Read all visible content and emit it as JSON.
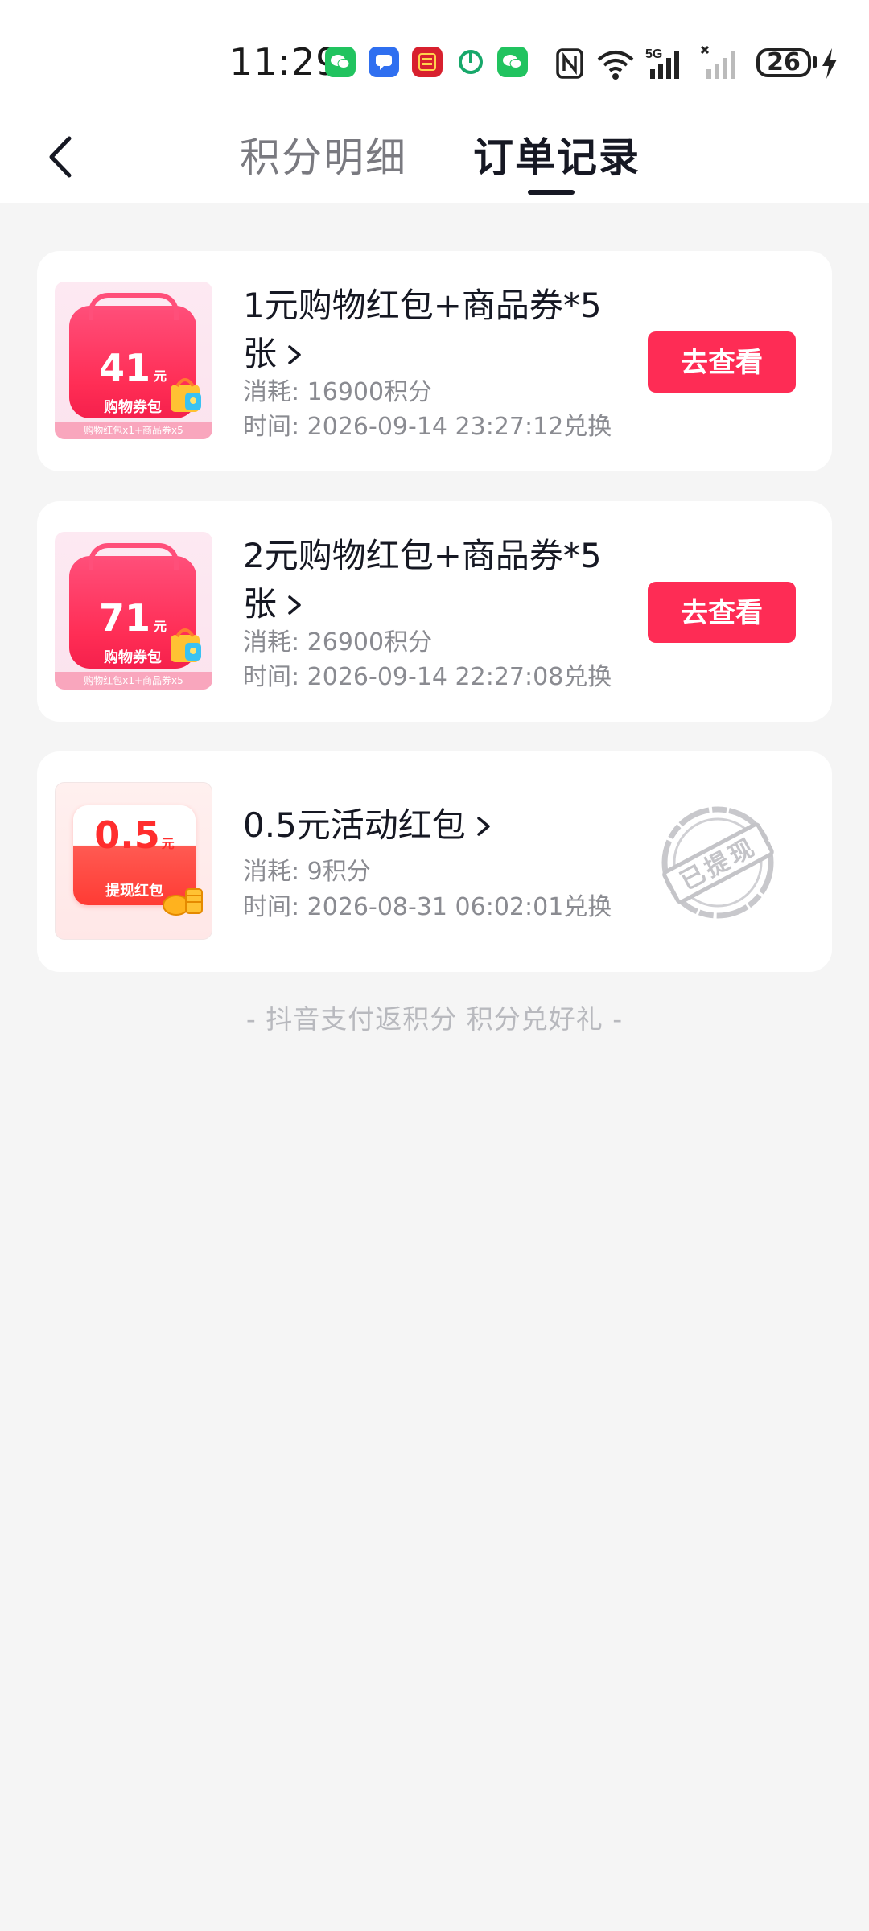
{
  "status_bar": {
    "time": "11:29",
    "app_icons": [
      "wechat-icon",
      "message-icon",
      "news-icon",
      "power-icon",
      "wechat-icon"
    ],
    "signal": "5G",
    "battery": "26"
  },
  "header": {
    "tabs": [
      {
        "label": "积分明细",
        "active": false
      },
      {
        "label": "订单记录",
        "active": true
      }
    ]
  },
  "orders": [
    {
      "title": "1元购物红包+商品券*5张",
      "thumb_amount": "41",
      "thumb_unit": "元",
      "thumb_label": "购物券包",
      "thumb_footer": "购物红包x1+商品券x5",
      "cost_label": "消耗:",
      "cost_value": "16900积分",
      "time_label": "时间:",
      "time_value": "2026-09-14 23:27:12兑换",
      "action_label": "去查看"
    },
    {
      "title": "2元购物红包+商品券*5张",
      "thumb_amount": "71",
      "thumb_unit": "元",
      "thumb_label": "购物券包",
      "thumb_footer": "购物红包x1+商品券x5",
      "cost_label": "消耗:",
      "cost_value": "26900积分",
      "time_label": "时间:",
      "time_value": "2026-09-14 22:27:08兑换",
      "action_label": "去查看"
    },
    {
      "title": "0.5元活动红包",
      "thumb_amount": "0.5",
      "thumb_unit": "元",
      "thumb_label": "提现红包",
      "cost_label": "消耗:",
      "cost_value": "9积分",
      "time_label": "时间:",
      "time_value": "2026-08-31 06:02:01兑换",
      "stamp_label": "已提现"
    }
  ],
  "footer_note": "- 抖音支付返积分 积分兑好礼 -",
  "colors": {
    "accent": "#fe2c55",
    "text_primary": "#161823",
    "text_secondary": "#8a8b91",
    "background": "#f5f5f5"
  }
}
